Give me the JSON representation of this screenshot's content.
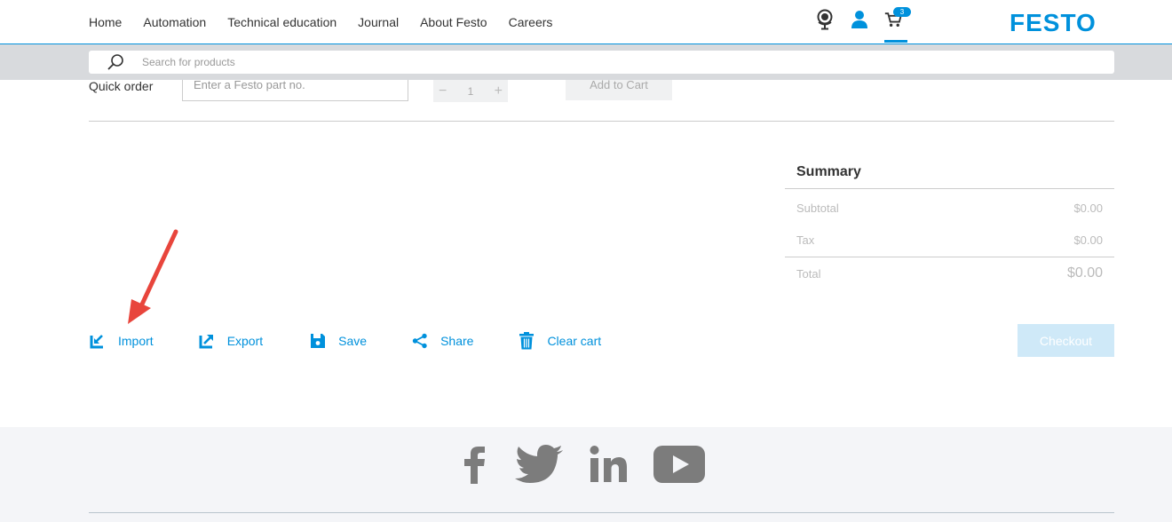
{
  "nav": {
    "items": [
      "Home",
      "Automation",
      "Technical education",
      "Journal",
      "About Festo",
      "Careers"
    ]
  },
  "header": {
    "logo": "FESTO",
    "cart_count": "3",
    "icons": [
      "globe-icon",
      "user-icon",
      "cart-icon"
    ]
  },
  "search": {
    "placeholder": "Search for products"
  },
  "quick_order": {
    "label": "Quick order",
    "part_placeholder": "Enter a Festo part no.",
    "quantity": "1",
    "minus": "−",
    "plus": "+",
    "add_label": "Add to Cart"
  },
  "summary": {
    "title": "Summary",
    "subtotal_label": "Subtotal",
    "subtotal_value": "$0.00",
    "tax_label": "Tax",
    "tax_value": "$0.00",
    "total_label": "Total",
    "total_value": "$0.00"
  },
  "actions": {
    "import": "Import",
    "export": "Export",
    "save": "Save",
    "share": "Share",
    "clear": "Clear cart",
    "checkout": "Checkout"
  },
  "footer": {
    "social": [
      "facebook-icon",
      "twitter-icon",
      "linkedin-icon",
      "youtube-icon"
    ]
  },
  "colors": {
    "accent": "#0091dc",
    "arrow": "#e8453c",
    "footer_bg": "#f4f5f8"
  }
}
